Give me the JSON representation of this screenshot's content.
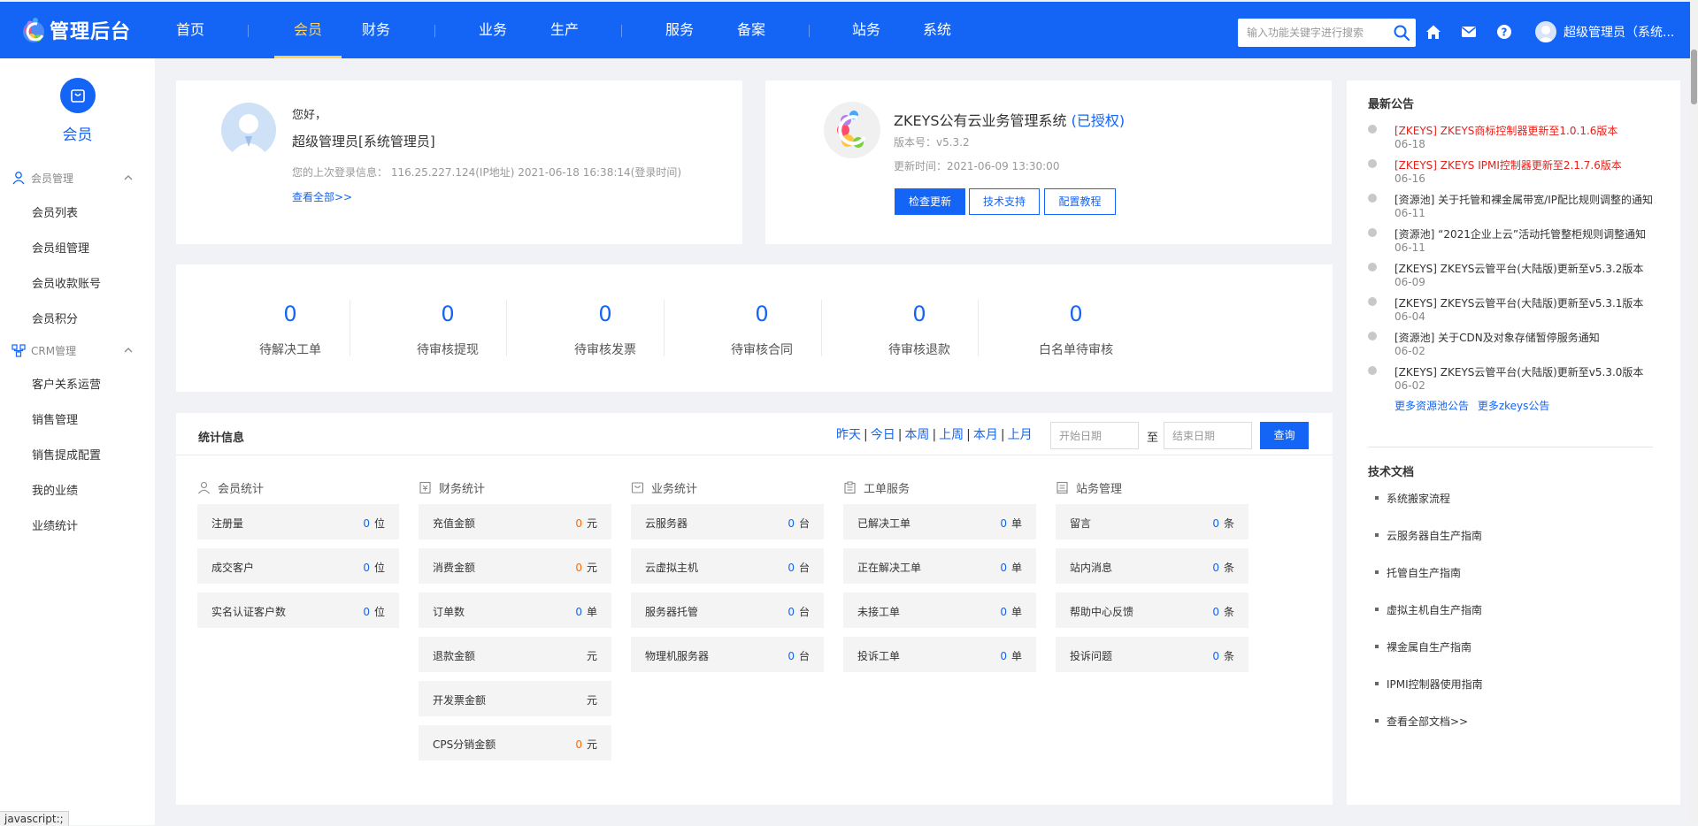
{
  "header": {
    "logo_text": "管理后台",
    "nav": [
      "首页",
      "会员",
      "财务",
      "业务",
      "生产",
      "服务",
      "备案",
      "站务",
      "系统"
    ],
    "active_nav": "会员",
    "search_placeholder": "输入功能关键字进行搜索",
    "user": "超级管理员（系统..."
  },
  "sidebar": {
    "title": "会员",
    "groups": [
      {
        "label": "会员管理",
        "items": [
          "会员列表",
          "会员组管理",
          "会员收款账号",
          "会员积分"
        ]
      },
      {
        "label": "CRM管理",
        "items": [
          "客户关系运营",
          "销售管理",
          "销售提成配置",
          "我的业绩",
          "业绩统计"
        ]
      }
    ]
  },
  "welcome": {
    "greeting": "您好，",
    "name": "超级管理员[系统管理员]",
    "last_login": "您的上次登录信息：  116.25.227.124(IP地址) 2021-06-18 16:38:14(登录时间)",
    "view_all": "查看全部>>"
  },
  "system": {
    "title": "ZKEYS公有云业务管理系统",
    "authorized": "(已授权)",
    "version": "版本号：v5.3.2",
    "update_time": "更新时间：2021-06-09 13:30:00",
    "buttons": [
      "检查更新",
      "技术支持",
      "配置教程"
    ]
  },
  "pending": [
    {
      "value": "0",
      "label": "待解决工单"
    },
    {
      "value": "0",
      "label": "待审核提现"
    },
    {
      "value": "0",
      "label": "待审核发票"
    },
    {
      "value": "0",
      "label": "待审核合同"
    },
    {
      "value": "0",
      "label": "待审核退款"
    },
    {
      "value": "0",
      "label": "白名单待审核"
    }
  ],
  "stats": {
    "title": "统计信息",
    "ranges": [
      "昨天",
      "今日",
      "本周",
      "上周",
      "本月",
      "上月"
    ],
    "start_placeholder": "开始日期",
    "to": "至",
    "end_placeholder": "结束日期",
    "query": "查询",
    "columns": [
      {
        "title": "会员统计",
        "rows": [
          {
            "label": "注册量",
            "num": "0",
            "unit": "位",
            "highlight": false
          },
          {
            "label": "成交客户",
            "num": "0",
            "unit": "位",
            "highlight": false
          },
          {
            "label": "实名认证客户数",
            "num": "0",
            "unit": "位",
            "highlight": false
          }
        ]
      },
      {
        "title": "财务统计",
        "rows": [
          {
            "label": "充值金额",
            "num": "0",
            "unit": "元",
            "highlight": true
          },
          {
            "label": "消费金额",
            "num": "0",
            "unit": "元",
            "highlight": true
          },
          {
            "label": "订单数",
            "num": "0",
            "unit": "单",
            "highlight": false
          },
          {
            "label": "退款金额",
            "num": "",
            "unit": "元",
            "highlight": false
          },
          {
            "label": "开发票金额",
            "num": "",
            "unit": "元",
            "highlight": false
          },
          {
            "label": "CPS分销金额",
            "num": "0",
            "unit": "元",
            "highlight": true
          }
        ]
      },
      {
        "title": "业务统计",
        "rows": [
          {
            "label": "云服务器",
            "num": "0",
            "unit": "台",
            "highlight": false
          },
          {
            "label": "云虚拟主机",
            "num": "0",
            "unit": "台",
            "highlight": false
          },
          {
            "label": "服务器托管",
            "num": "0",
            "unit": "台",
            "highlight": false
          },
          {
            "label": "物理机服务器",
            "num": "0",
            "unit": "台",
            "highlight": false
          }
        ]
      },
      {
        "title": "工单服务",
        "rows": [
          {
            "label": "已解决工单",
            "num": "0",
            "unit": "单",
            "highlight": false
          },
          {
            "label": "正在解决工单",
            "num": "0",
            "unit": "单",
            "highlight": false
          },
          {
            "label": "未接工单",
            "num": "0",
            "unit": "单",
            "highlight": false
          },
          {
            "label": "投诉工单",
            "num": "0",
            "unit": "单",
            "highlight": false
          }
        ]
      },
      {
        "title": "站务管理",
        "rows": [
          {
            "label": "留言",
            "num": "0",
            "unit": "条",
            "highlight": false
          },
          {
            "label": "站内消息",
            "num": "0",
            "unit": "条",
            "highlight": false
          },
          {
            "label": "帮助中心反馈",
            "num": "0",
            "unit": "条",
            "highlight": false
          },
          {
            "label": "投诉问题",
            "num": "0",
            "unit": "条",
            "highlight": false
          }
        ]
      }
    ]
  },
  "notices": {
    "title": "最新公告",
    "items": [
      {
        "text": "[ZKEYS] ZKEYS商标控制器更新至1.0.1.6版本",
        "date": "06-18",
        "red": true
      },
      {
        "text": "[ZKEYS] ZKEYS IPMI控制器更新至2.1.7.6版本",
        "date": "06-16",
        "red": true
      },
      {
        "text": "[资源池] 关于托管和裸金属带宽/IP配比规则调整的通知",
        "date": "06-11",
        "red": false
      },
      {
        "text": "[资源池] “2021企业上云”活动托管整柜规则调整通知",
        "date": "06-11",
        "red": false
      },
      {
        "text": "[ZKEYS] ZKEYS云管平台(大陆版)更新至v5.3.2版本",
        "date": "06-09",
        "red": false
      },
      {
        "text": "[ZKEYS] ZKEYS云管平台(大陆版)更新至v5.3.1版本",
        "date": "06-04",
        "red": false
      },
      {
        "text": "[资源池] 关于CDN及对象存储暂停服务通知",
        "date": "06-02",
        "red": false
      },
      {
        "text": "[ZKEYS] ZKEYS云管平台(大陆版)更新至v5.3.0版本",
        "date": "06-02",
        "red": false
      }
    ],
    "more": [
      "更多资源池公告",
      "更多zkeys公告"
    ]
  },
  "docs": {
    "title": "技术文档",
    "items": [
      "系统搬家流程",
      "云服务器自生产指南",
      "托管自生产指南",
      "虚拟主机自生产指南",
      "裸金属自生产指南",
      "IPMI控制器使用指南",
      "查看全部文档>>"
    ]
  },
  "status_bar": "javascript:;",
  "colors": {
    "primary": "#1465f5",
    "active_nav": "#ffd35a",
    "alert": "#e8201a",
    "amount": "#ff6a00"
  }
}
